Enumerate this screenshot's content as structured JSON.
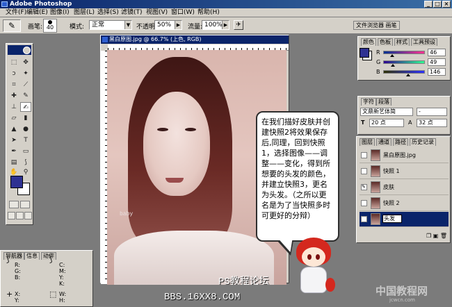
{
  "app": {
    "title": "Adobe Photoshop"
  },
  "menu": [
    "文件(F)",
    "编辑(E)",
    "图像(I)",
    "图层(L)",
    "选择(S)",
    "滤镜(T)",
    "视图(V)",
    "窗口(W)",
    "帮助(H)"
  ],
  "options": {
    "brush_label": "画笔:",
    "brush_size": "40",
    "mode_label": "模式:",
    "mode_value": "正常",
    "opacity_label": "不透明度:",
    "opacity_value": "50%",
    "flow_label": "流量:",
    "flow_value": "100%",
    "well_tabs": [
      "文件浏览器",
      "画笔"
    ]
  },
  "document": {
    "title": "黑白原图.jpg @ 66.7% (上色, RGB)",
    "watermark_top": "PS教程论坛",
    "watermark_bottom": "BBS.16XX8.COM",
    "shirt_text": "baby"
  },
  "bubble": {
    "text": "在我们描好皮肤并创建快照2将效果保存后,同理，回到快照1，选择图像——调整——变化，得到所想要的头发的颜色，并建立快照3，更名为头发。（之所以更名是为了当快照多时可更好的分辩）"
  },
  "color_panel": {
    "tabs": [
      "颜色",
      "色板",
      "样式",
      "工具预设"
    ],
    "channels": [
      {
        "label": "R",
        "value": "46"
      },
      {
        "label": "G",
        "value": "49"
      },
      {
        "label": "B",
        "value": "146"
      }
    ],
    "fg_color": "#2e3192"
  },
  "char_panel": {
    "tabs": [
      "字符",
      "段落"
    ],
    "font": "文鼎新艺体简",
    "style": "-",
    "size": "20 点",
    "leading": "32 点"
  },
  "history_panel": {
    "tabs": [
      "图层",
      "通道",
      "路径",
      "历史记录"
    ],
    "items": [
      {
        "label": "黑白原图.jpg"
      },
      {
        "label": "快照 1"
      },
      {
        "label": "皮肤"
      },
      {
        "label": "快照 2"
      },
      {
        "label": "头发"
      }
    ]
  },
  "nav_panel": {
    "tabs": [
      "导航器",
      "信息",
      "动作"
    ],
    "cells": [
      "R:\nG:\nB:",
      "C:\nM:\nY:\nK:",
      "X:\nY:",
      "W:\nH:"
    ]
  },
  "site_logo": {
    "text": "中国教程网",
    "sub": "jcwcn.com"
  }
}
